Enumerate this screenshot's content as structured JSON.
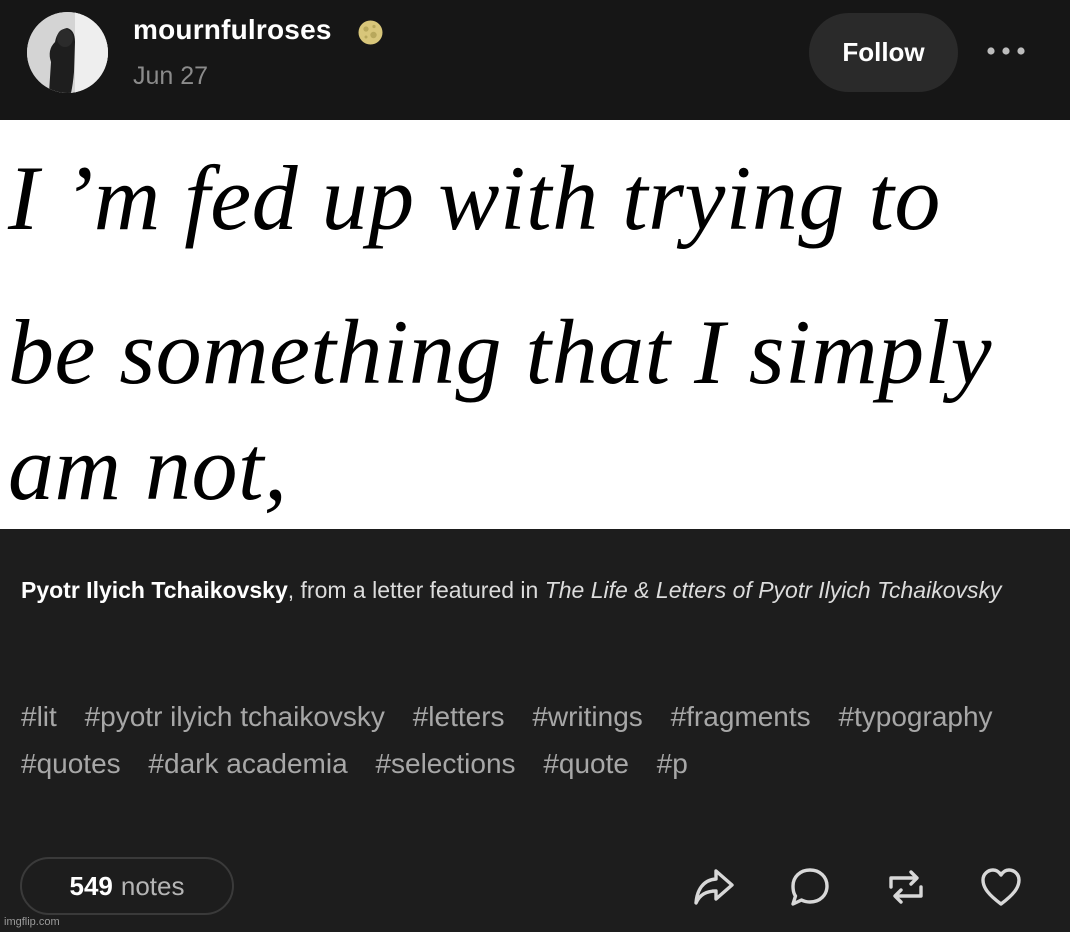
{
  "post": {
    "username": "mournfulroses",
    "date": "Jun 27",
    "follow_label": "Follow",
    "quote_lines": [
      "I ’m fed up with trying to",
      "be something that I simply",
      "am not,"
    ],
    "caption": {
      "author": "Pyotr Ilyich Tchaikovsky",
      "middle": ", from a letter featured in ",
      "book": "The Life & Letters of Pyotr Ilyich Tchaikovsky"
    },
    "tags": [
      "#lit",
      "#pyotr ilyich tchaikovsky",
      "#letters",
      "#writings",
      "#fragments",
      "#typography",
      "#quotes",
      "#dark academia",
      "#selections",
      "#quote",
      "#p"
    ],
    "notes": {
      "count": "549",
      "label": "notes"
    }
  },
  "icons": {
    "badge": "moon-badge-icon",
    "more": "more-options-icon",
    "share": "share-icon",
    "reply": "reply-icon",
    "reblog": "reblog-icon",
    "like": "heart-icon"
  },
  "watermark": "imgflip.com",
  "colors": {
    "background": "#1d1d1d",
    "header": "#161616",
    "tag": "#a7a7a7",
    "muted": "#8b8b8b"
  }
}
